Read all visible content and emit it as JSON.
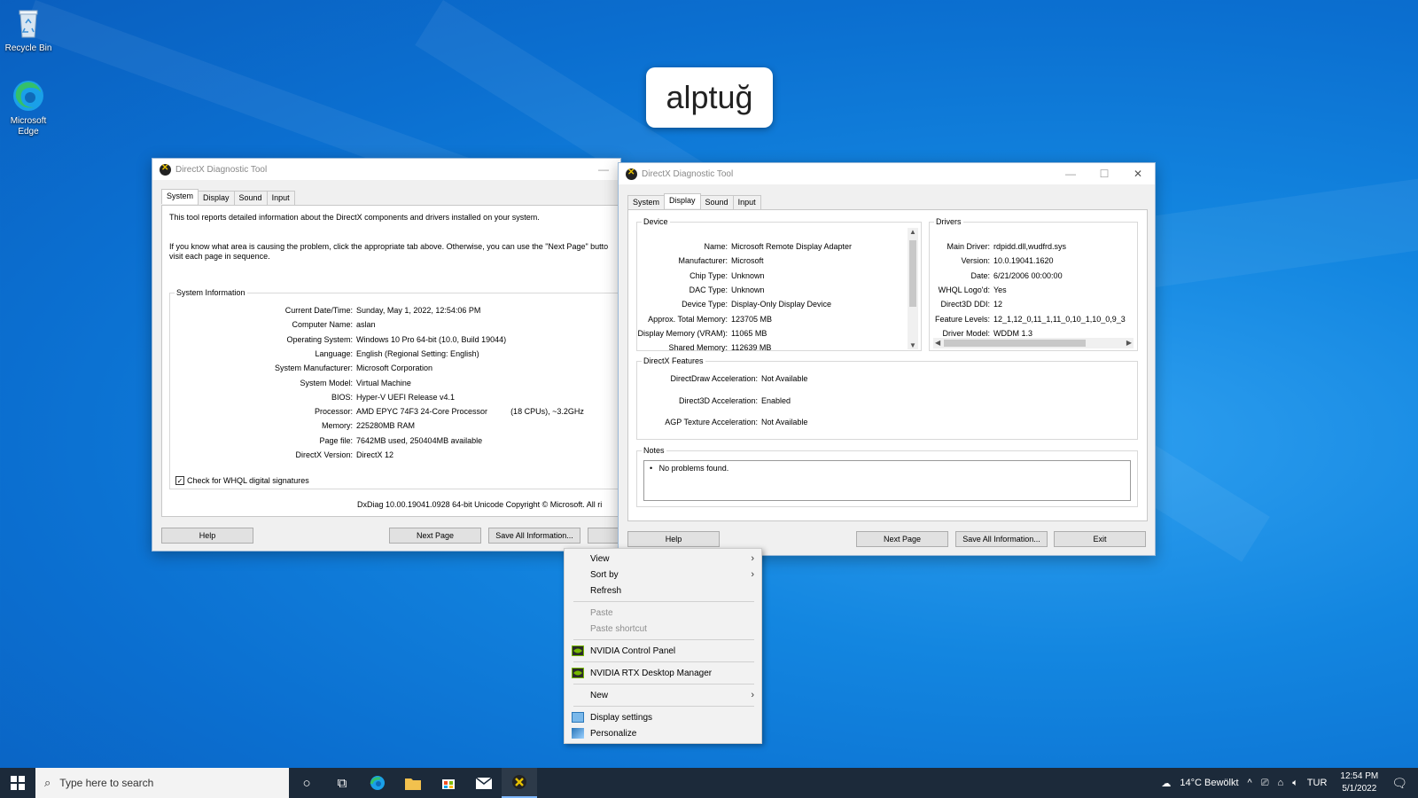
{
  "desktop": {
    "icons": [
      {
        "label": "Recycle Bin",
        "icon": "recycle-bin-icon"
      },
      {
        "label": "Microsoft Edge",
        "icon": "edge-icon"
      }
    ],
    "bubble_text": "alptuğ"
  },
  "win1": {
    "title": "DirectX Diagnostic Tool",
    "tabs": [
      "System",
      "Display",
      "Sound",
      "Input"
    ],
    "intro1": "This tool reports detailed information about the DirectX components and drivers installed on your system.",
    "intro2": "If you know what area is causing the problem, click the appropriate tab above.  Otherwise, you can use the \"Next Page\" butto",
    "intro3": "visit each page in sequence.",
    "sysinfo_title": "System Information",
    "rows": [
      {
        "k": "Current Date/Time:",
        "v": "Sunday, May 1, 2022, 12:54:06 PM"
      },
      {
        "k": "Computer Name:",
        "v": "aslan"
      },
      {
        "k": "Operating System:",
        "v": "Windows 10 Pro 64-bit (10.0, Build 19044)"
      },
      {
        "k": "Language:",
        "v": "English (Regional Setting: English)"
      },
      {
        "k": "System Manufacturer:",
        "v": "Microsoft Corporation"
      },
      {
        "k": "System Model:",
        "v": "Virtual Machine"
      },
      {
        "k": "BIOS:",
        "v": "Hyper-V UEFI Release v4.1"
      },
      {
        "k": "Processor:",
        "v": "AMD EPYC 74F3 24-Core Processor"
      },
      {
        "k": "Memory:",
        "v": "225280MB RAM"
      },
      {
        "k": "Page file:",
        "v": "7642MB used, 250404MB available"
      },
      {
        "k": "DirectX Version:",
        "v": "DirectX 12"
      }
    ],
    "processor_extra": "(18 CPUs), ~3.2GHz",
    "whql_label": "Check for WHQL digital signatures",
    "whql_checked": true,
    "footer": "DxDiag 10.00.19041.0928 64-bit Unicode  Copyright © Microsoft. All ri",
    "buttons": {
      "help": "Help",
      "next": "Next Page",
      "save": "Save All Information..."
    }
  },
  "win2": {
    "title": "DirectX Diagnostic Tool",
    "tabs": [
      "System",
      "Display",
      "Sound",
      "Input"
    ],
    "device_title": "Device",
    "device_rows": [
      {
        "k": "Name:",
        "v": "Microsoft Remote Display Adapter"
      },
      {
        "k": "Manufacturer:",
        "v": "Microsoft"
      },
      {
        "k": "Chip Type:",
        "v": "Unknown"
      },
      {
        "k": "DAC Type:",
        "v": "Unknown"
      },
      {
        "k": "Device Type:",
        "v": "Display-Only Display Device"
      },
      {
        "k": "Approx. Total Memory:",
        "v": "123705 MB"
      },
      {
        "k": "Display Memory (VRAM):",
        "v": "11065 MB"
      },
      {
        "k": "Shared Memory:",
        "v": "112639 MB"
      }
    ],
    "drivers_title": "Drivers",
    "driver_rows": [
      {
        "k": "Main Driver:",
        "v": "rdpidd.dll,wudfrd.sys"
      },
      {
        "k": "Version:",
        "v": "10.0.19041.1620"
      },
      {
        "k": "Date:",
        "v": "6/21/2006 00:00:00"
      },
      {
        "k": "WHQL Logo'd:",
        "v": "Yes"
      },
      {
        "k": "Direct3D DDI:",
        "v": "12"
      },
      {
        "k": "Feature Levels:",
        "v": "12_1,12_0,11_1,11_0,10_1,10_0,9_3"
      },
      {
        "k": "Driver Model:",
        "v": "WDDM 1.3"
      }
    ],
    "features_title": "DirectX Features",
    "feature_rows": [
      {
        "k": "DirectDraw Acceleration:",
        "v": "Not Available"
      },
      {
        "k": "Direct3D Acceleration:",
        "v": "Enabled"
      },
      {
        "k": "AGP Texture Acceleration:",
        "v": "Not Available"
      }
    ],
    "notes_title": "Notes",
    "notes_text": "No problems found.",
    "buttons": {
      "help": "Help",
      "next": "Next Page",
      "save": "Save All Information...",
      "exit": "Exit"
    }
  },
  "menu": {
    "view": "View",
    "sort_by": "Sort by",
    "refresh": "Refresh",
    "paste": "Paste",
    "paste_shortcut": "Paste shortcut",
    "nvidia_cp": "NVIDIA Control Panel",
    "nvidia_rtx": "NVIDIA RTX Desktop Manager",
    "new": "New",
    "display_settings": "Display settings",
    "personalize": "Personalize"
  },
  "taskbar": {
    "search_placeholder": "Type here to search",
    "weather": "14°C  Bewölkt",
    "lang": "TUR",
    "time": "12:54 PM",
    "date": "5/1/2022"
  },
  "colors": {
    "accent": "#0a6fd0",
    "taskbar": "#1c2a3a",
    "nvidia": "#76b900"
  }
}
